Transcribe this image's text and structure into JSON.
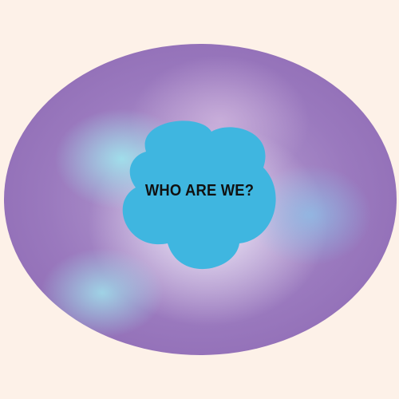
{
  "headline": "WHO ARE WE?",
  "colors": {
    "background": "#fdf1e8",
    "ellipse_base": "#9a79be",
    "ellipse_highlight": "#a0e2ec",
    "blob": "#3fb6e0",
    "text": "#111111"
  }
}
